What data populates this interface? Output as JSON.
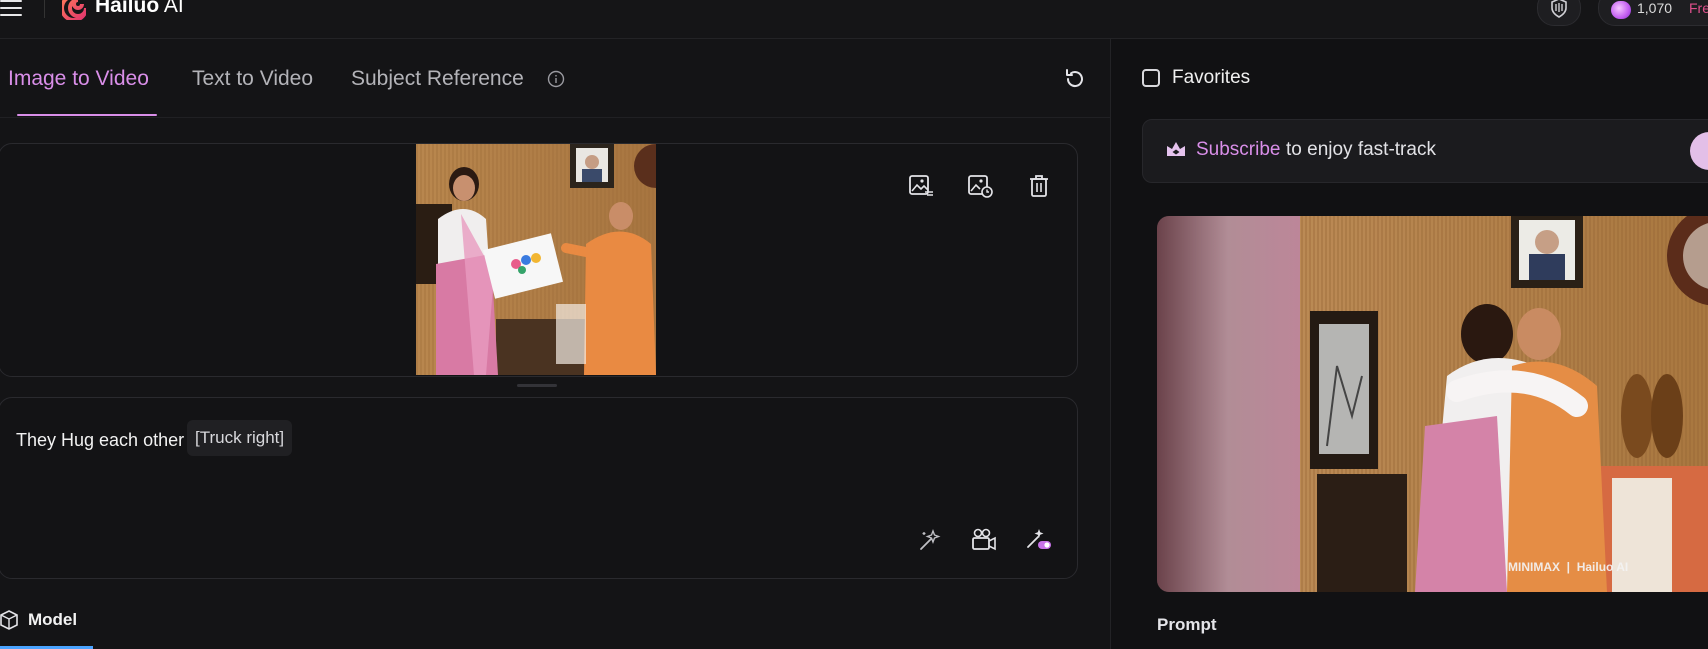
{
  "header": {
    "brand_bold": "Hailuo",
    "brand_light": "AI",
    "credits": "1,070",
    "free_label": "Fre"
  },
  "tabs": [
    {
      "label": "Image to Video",
      "active": true
    },
    {
      "label": "Text to Video",
      "active": false
    },
    {
      "label": "Subject Reference",
      "active": false
    }
  ],
  "prompt": {
    "text": "They Hug each other",
    "camera_tag": "[Truck right]"
  },
  "model": {
    "label": "Model"
  },
  "favorites": {
    "label": "Favorites",
    "checked": false
  },
  "subscribe": {
    "link": "Subscribe",
    "rest": "to enjoy fast-track"
  },
  "preview": {
    "watermark_left": "MINIMAX",
    "watermark_right": "Hailuo AI",
    "prompt_heading": "Prompt"
  },
  "colors": {
    "accent": "#d98ee8",
    "background": "#141416",
    "free": "#e0508c"
  },
  "icons": [
    "menu-icon",
    "hailuo-logo",
    "shield-icon",
    "gem-icon",
    "info-icon",
    "refresh-icon",
    "image-edit-icon",
    "image-replace-icon",
    "trash-icon",
    "magic-wand-icon",
    "camera-icon",
    "enhance-prompt-icon",
    "model-cube-icon",
    "crown-icon"
  ]
}
